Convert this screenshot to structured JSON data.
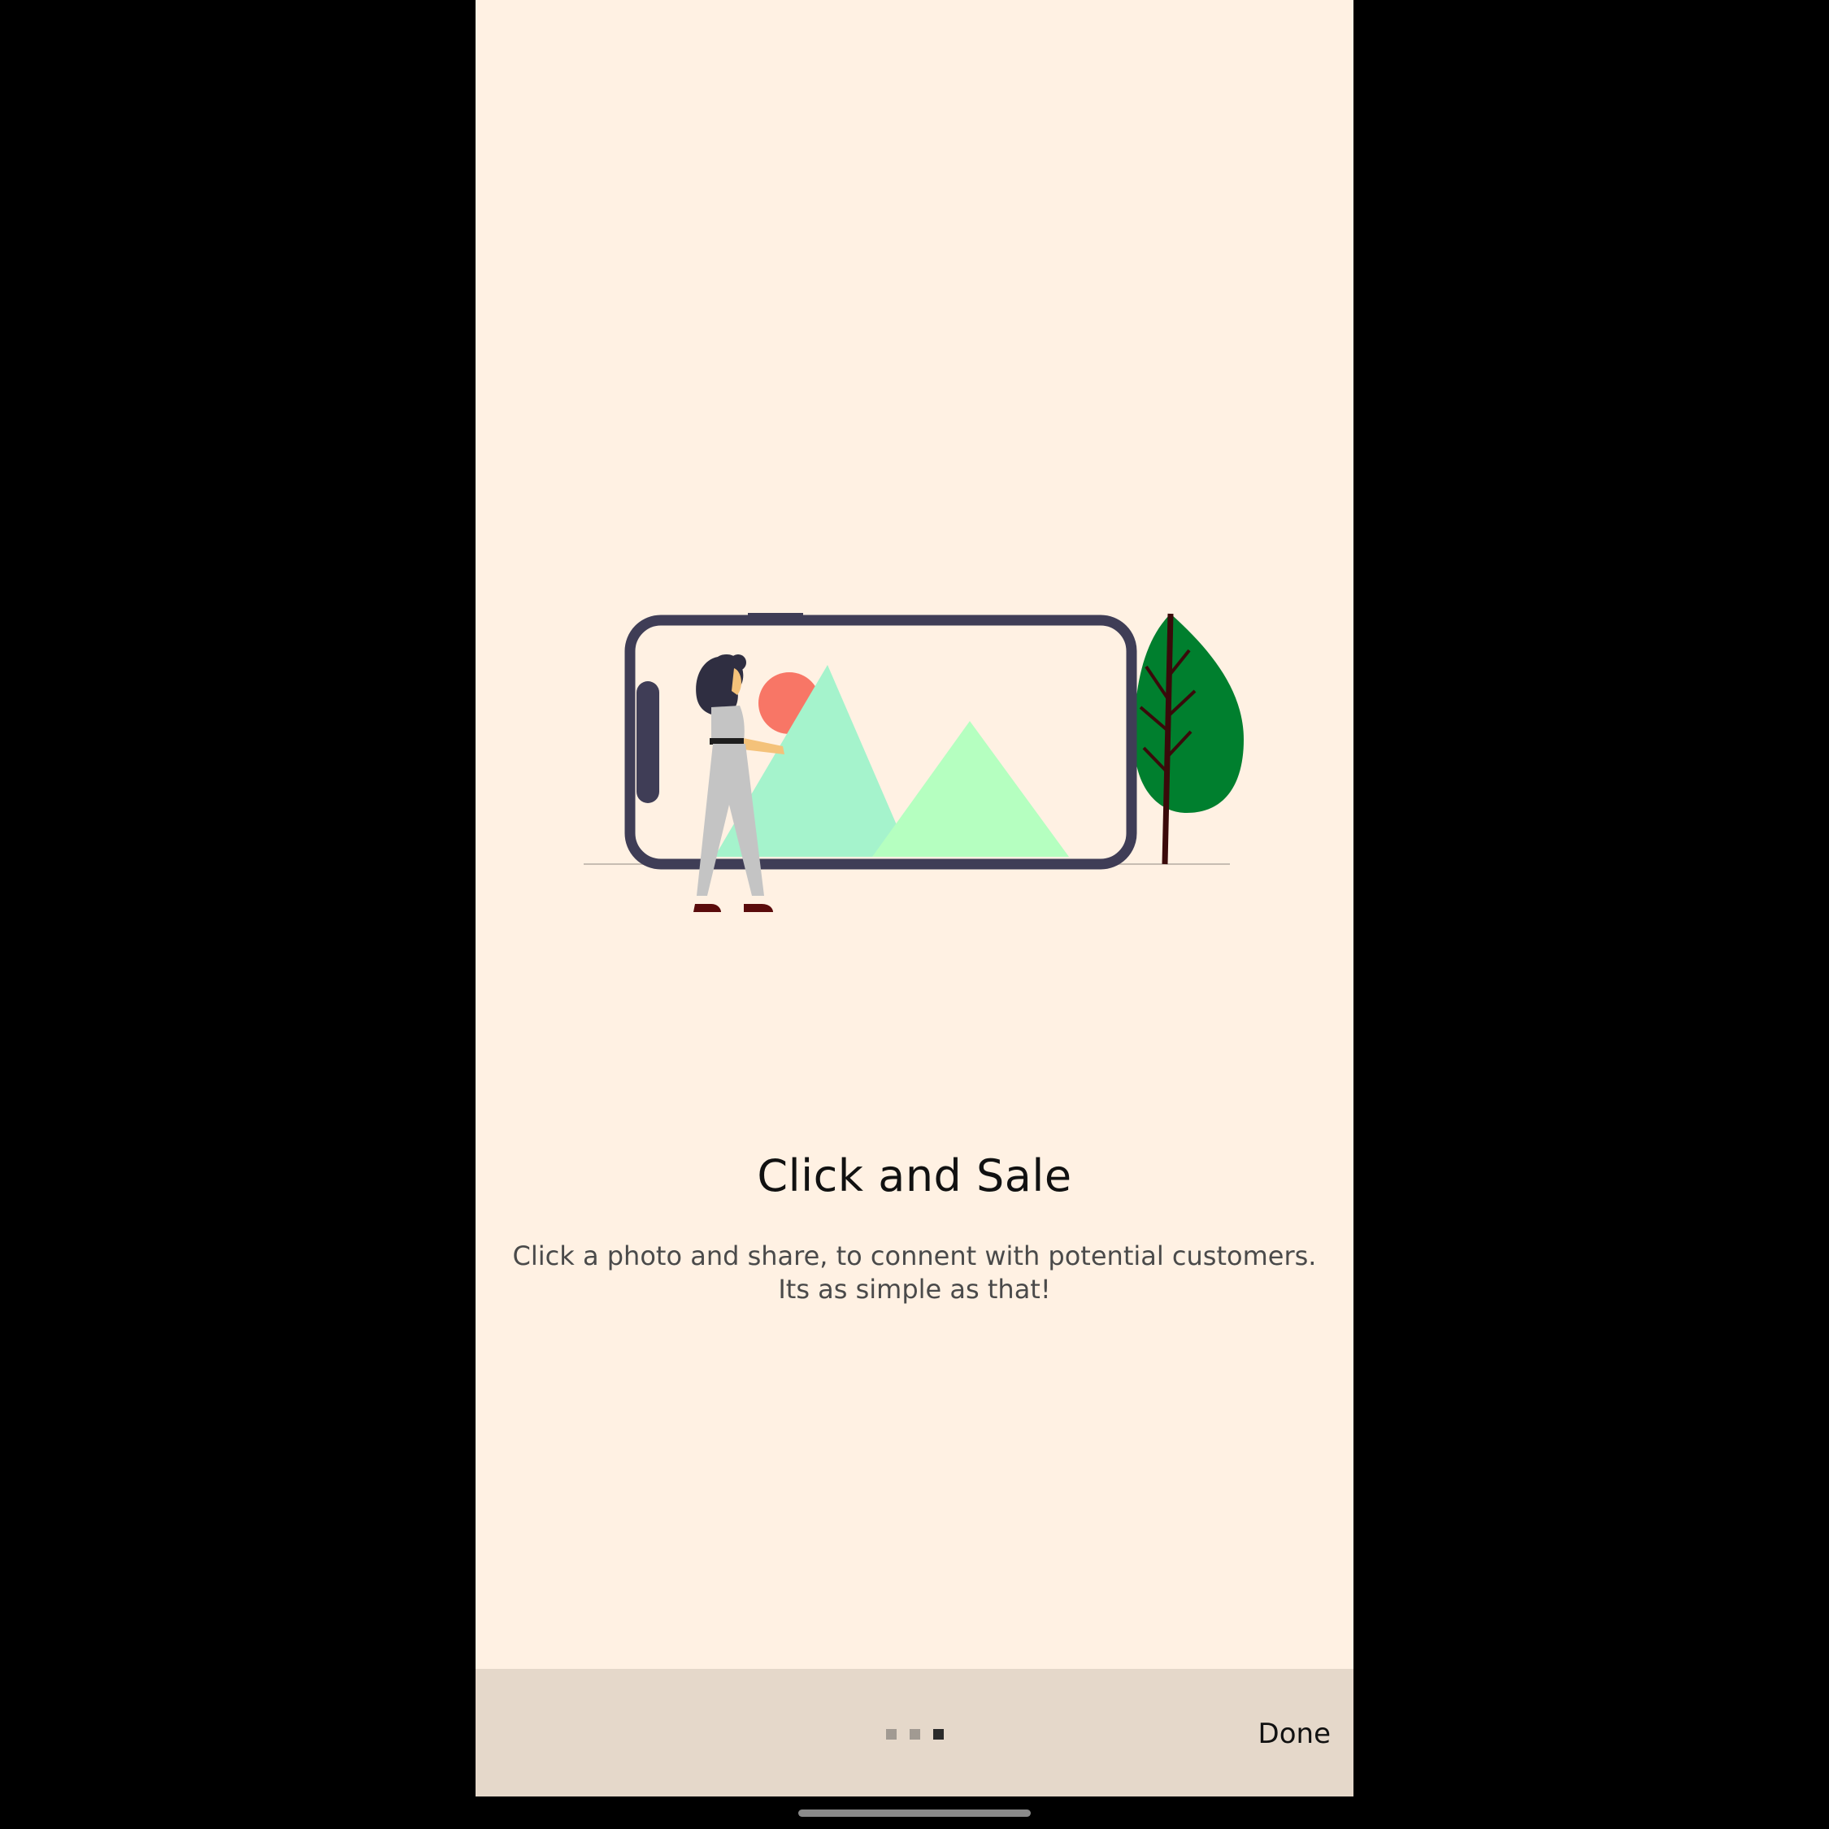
{
  "onboarding": {
    "title": "Click and Sale",
    "description": "Click a photo and share, to connent with potential customers. Its as simple as that!",
    "illustration_icon": "photo-capture-illustration"
  },
  "pager": {
    "total_pages": 3,
    "current_page": 3
  },
  "footer": {
    "done_label": "Done"
  },
  "colors": {
    "background": "#fff1e3",
    "footer_background": "#e5d8ca",
    "phone_frame": "#3f3d56",
    "mountain_left": "#a5f3cc",
    "mountain_right": "#b5ffc0",
    "sun": "#f87666",
    "tree": "#007f2e"
  }
}
